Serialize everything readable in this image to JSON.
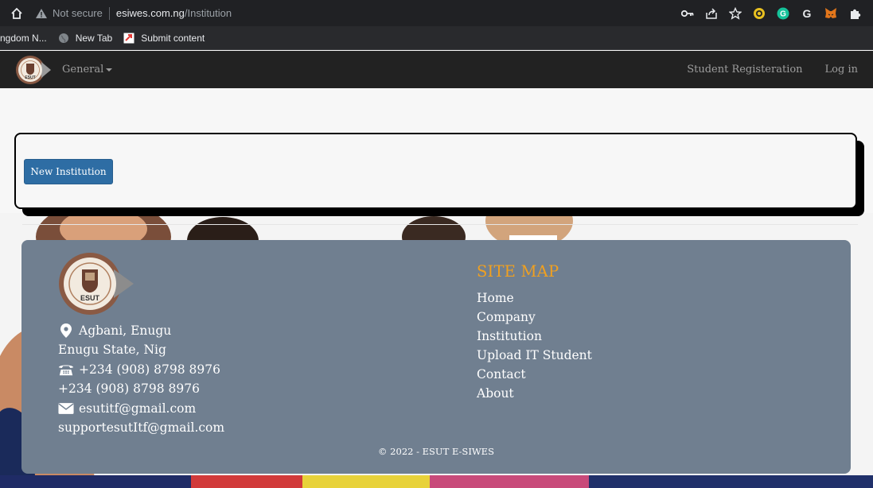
{
  "browser": {
    "security_label": "Not secure",
    "url_host": "esiwes.com.ng",
    "url_path": "/Institution",
    "bookmarks": [
      {
        "label": "ngdom N...",
        "icon": "none"
      },
      {
        "label": "New Tab",
        "icon": "globe-icon"
      },
      {
        "label": "Submit content",
        "icon": "submit-icon"
      }
    ],
    "extension_icons": [
      "key-icon",
      "share-icon",
      "star-icon",
      "coin-extension-icon",
      "grammarly-icon",
      "google-icon",
      "metamask-icon",
      "puzzle-icon"
    ]
  },
  "navbar": {
    "logo_text": "ESUT",
    "general_label": "General",
    "register_label": "Student Registeration",
    "login_label": "Log in"
  },
  "main": {
    "new_institution_label": "New Institution"
  },
  "footer": {
    "logo_text": "ESUT",
    "address_line1": "Agbani, Enugu",
    "address_line2": "Enugu State, Nig",
    "phone1": "+234 (908) 8798 8976",
    "phone2": "+234 (908) 8798 8976",
    "email1": "esutitf@gmail.com",
    "email2": "supportesutItf@gmail.com",
    "sitemap_title": "SITE MAP",
    "sitemap_links": [
      "Home",
      "Company",
      "Institution",
      "Upload IT Student",
      "Contact",
      "About"
    ],
    "copyright": "© 2022 - ESUT E-SIWES"
  },
  "colors": {
    "navbar_bg": "#222222",
    "button_primary": "#2e6da4",
    "footer_bg": "#707f90",
    "sitemap_title": "#f0a020"
  }
}
